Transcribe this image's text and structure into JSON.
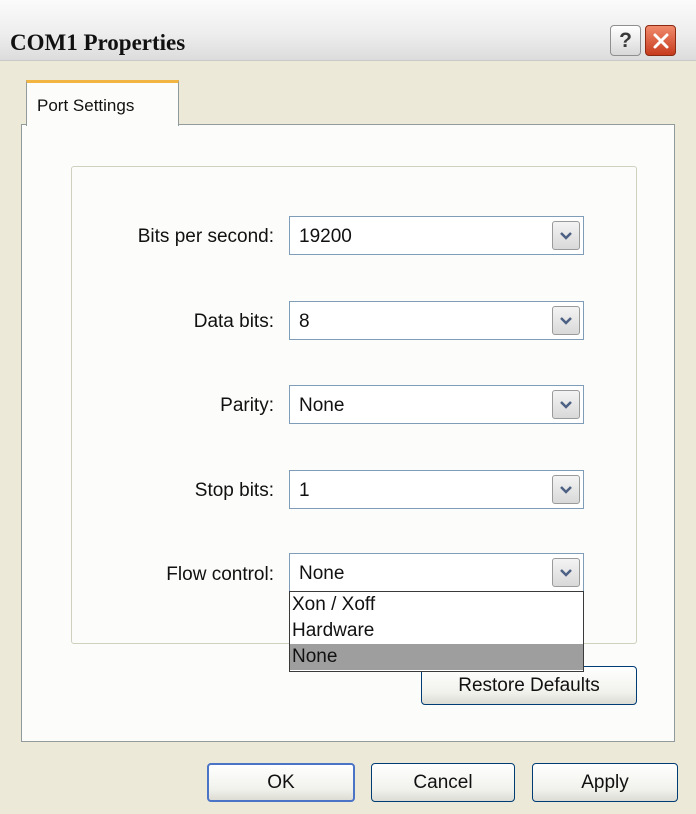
{
  "window": {
    "title": "COM1 Properties",
    "help_glyph": "?",
    "icons": {
      "help": "help-icon",
      "close": "close-icon"
    }
  },
  "tabs": [
    {
      "label": "Port Settings",
      "active": true
    }
  ],
  "form": {
    "bits_per_second": {
      "label": "Bits per second:",
      "value": "19200"
    },
    "data_bits": {
      "label": "Data bits:",
      "value": "8"
    },
    "parity": {
      "label": "Parity:",
      "value": "None"
    },
    "stop_bits": {
      "label": "Stop bits:",
      "value": "1"
    },
    "flow_control": {
      "label": "Flow control:",
      "value": "None"
    }
  },
  "flow_control_dropdown": {
    "options": [
      "Xon / Xoff",
      "Hardware",
      "None"
    ],
    "selected": "None"
  },
  "buttons": {
    "restore_defaults": "Restore Defaults",
    "ok": "OK",
    "cancel": "Cancel",
    "apply": "Apply"
  }
}
